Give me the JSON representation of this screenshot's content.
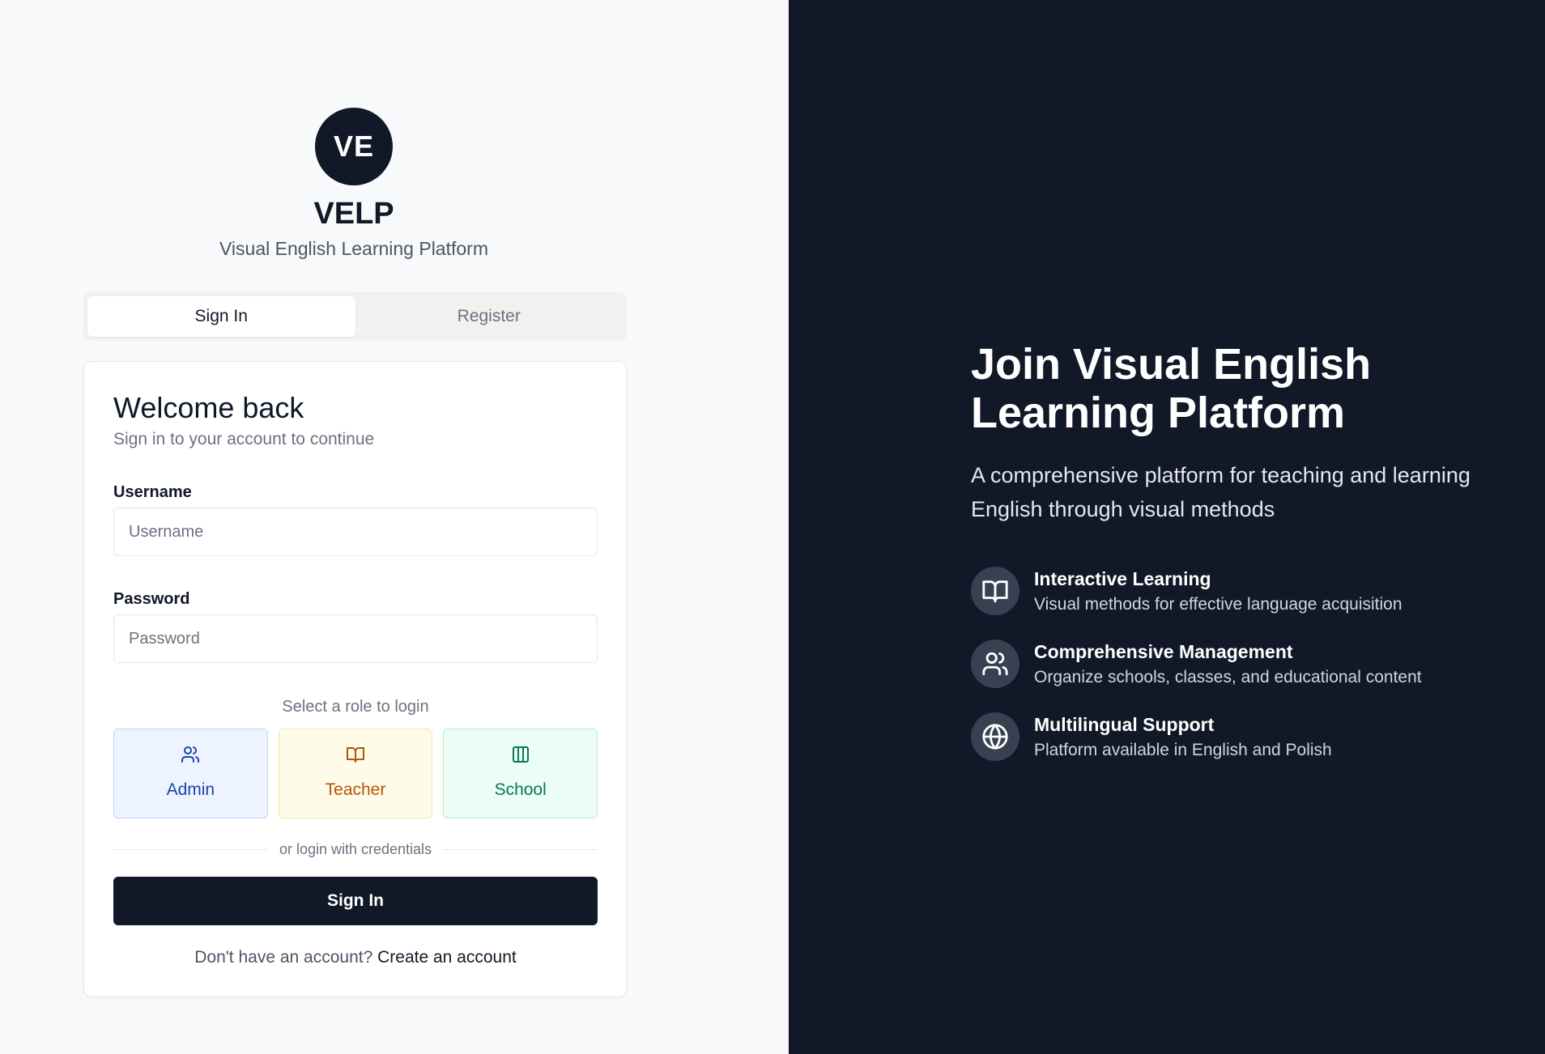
{
  "brand": {
    "logo_initials": "VE",
    "name": "VELP",
    "subtitle": "Visual English Learning Platform"
  },
  "tabs": [
    {
      "label": "Sign In",
      "active": true
    },
    {
      "label": "Register",
      "active": false
    }
  ],
  "form": {
    "title": "Welcome back",
    "description": "Sign in to your account to continue",
    "username_label": "Username",
    "username_placeholder": "Username",
    "username_value": "",
    "password_label": "Password",
    "password_placeholder": "Password",
    "password_value": "",
    "role_caption": "Select a role to login",
    "roles": [
      {
        "label": "Admin",
        "icon": "users-icon",
        "color": "#1e40af"
      },
      {
        "label": "Teacher",
        "icon": "book-open-icon",
        "color": "#b45309"
      },
      {
        "label": "School",
        "icon": "columns-icon",
        "color": "#047857"
      }
    ],
    "divider_text": "or login with credentials",
    "submit_label": "Sign In",
    "signup_prompt": "Don't have an account?",
    "signup_link": "Create an account"
  },
  "hero": {
    "title_line1": "Join Visual English",
    "title_line2": "Learning Platform",
    "description_line1": "A comprehensive platform for teaching and learning",
    "description_line2": "English through visual methods",
    "features": [
      {
        "icon": "book-open-icon",
        "title": "Interactive Learning",
        "description": "Visual methods for effective language acquisition"
      },
      {
        "icon": "users-icon",
        "title": "Comprehensive Management",
        "description": "Organize schools, classes, and educational content"
      },
      {
        "icon": "globe-icon",
        "title": "Multilingual Support",
        "description": "Platform available in English and Polish"
      }
    ]
  },
  "colors": {
    "dark": "#111827",
    "left_bg": "#f8f9fa"
  }
}
